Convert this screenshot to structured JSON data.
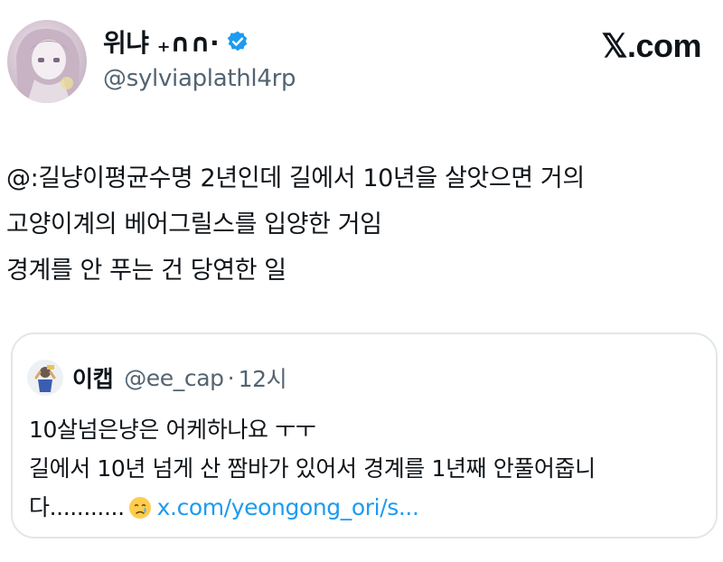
{
  "author": {
    "display_name": "위냐 ₊∩∩‧",
    "handle": "@sylviaplathl4rp"
  },
  "brand": {
    "label": "𝕏.com"
  },
  "tweet": {
    "lines": [
      "@:길냥이평균수명 2년인데 길에서 10년을 살앗으면 거의",
      "고양이계의 베어그릴스를 입양한 거임",
      "경계를 안 푸는 건 당연한 일"
    ]
  },
  "quote": {
    "name": "이캡",
    "handle": "@ee_cap",
    "separator": "·",
    "time": "12시",
    "lines": [
      "10살넘은냥은 어케하나요 ㅜㅜ",
      "길에서 10년 넘게 산 짬바가 있어서 경계를 1년째 안풀어줍니"
    ],
    "last_line_text": "다...........",
    "emoji_icon": "crying-face-emoji",
    "link": "x.com/yeongong_ori/s..."
  },
  "colors": {
    "text": "#0f1419",
    "secondary": "#536471",
    "link": "#1d9bf0",
    "verified": "#1d9bf0",
    "border": "#e1e6ea"
  }
}
